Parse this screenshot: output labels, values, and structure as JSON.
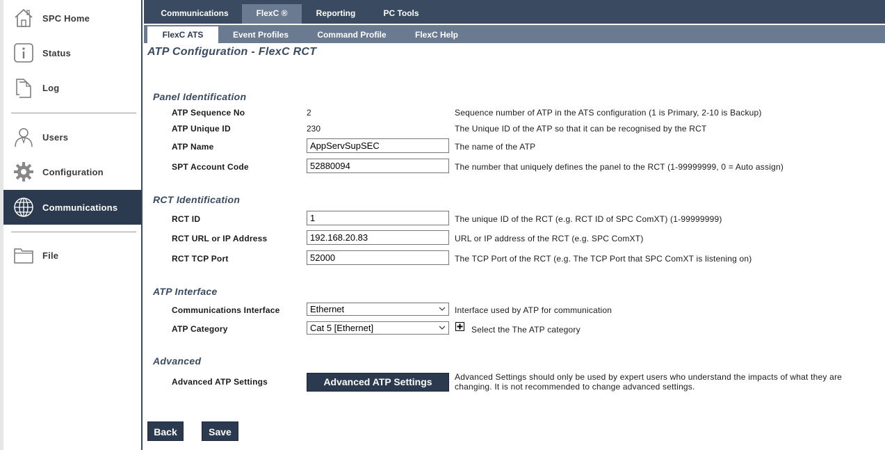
{
  "sidebar": {
    "items": [
      {
        "label": "SPC Home",
        "icon": "house-icon"
      },
      {
        "label": "Status",
        "icon": "info-icon"
      },
      {
        "label": "Log",
        "icon": "document-icon"
      },
      {
        "label": "Users",
        "icon": "user-icon"
      },
      {
        "label": "Configuration",
        "icon": "gear-icon"
      },
      {
        "label": "Communications",
        "icon": "globe-icon",
        "active": true
      },
      {
        "label": "File",
        "icon": "folder-icon"
      }
    ]
  },
  "tabs": [
    "Communications",
    "FlexC ®",
    "Reporting",
    "PC Tools"
  ],
  "active_tab": "FlexC ®",
  "subtabs": [
    "FlexC ATS",
    "Event Profiles",
    "Command Profile",
    "FlexC Help"
  ],
  "active_subtab": "FlexC ATS",
  "page_title": "ATP Configuration - FlexC RCT",
  "sections": {
    "panel_identification": {
      "title": "Panel Identification",
      "sequence_no": {
        "label": "ATP Sequence No",
        "value": "2",
        "desc": "Sequence number of ATP in the ATS configuration (1 is Primary, 2-10 is Backup)"
      },
      "unique_id": {
        "label": "ATP Unique ID",
        "value": "230",
        "desc": "The Unique ID of the ATP so that it can be recognised by the RCT"
      },
      "atp_name": {
        "label": "ATP Name",
        "value": "AppServSupSEC",
        "desc": "The name of the ATP"
      },
      "spt_account": {
        "label": "SPT Account Code",
        "value": "52880094",
        "desc": "The number that uniquely defines the panel to the RCT (1-99999999, 0 = Auto assign)"
      }
    },
    "rct_identification": {
      "title": "RCT Identification",
      "rct_id": {
        "label": "RCT ID",
        "value": "1",
        "desc": "The unique ID of the RCT (e.g. RCT ID of SPC ComXT) (1-99999999)"
      },
      "rct_url": {
        "label": "RCT URL or IP Address",
        "value": "192.168.20.83",
        "desc": "URL or IP address of the RCT (e.g. SPC ComXT)"
      },
      "rct_port": {
        "label": "RCT TCP Port",
        "value": "52000",
        "desc": "The TCP Port of the RCT (e.g. The TCP Port that SPC ComXT is listening on)"
      }
    },
    "atp_interface": {
      "title": "ATP Interface",
      "comm_interface": {
        "label": "Communications Interface",
        "value": "Ethernet",
        "desc": "Interface used by ATP for communication"
      },
      "atp_category": {
        "label": "ATP Category",
        "value": "Cat 5 [Ethernet]",
        "desc": "Select the The ATP category"
      }
    },
    "advanced": {
      "title": "Advanced",
      "label": "Advanced ATP Settings",
      "button": "Advanced ATP Settings",
      "desc_line1": "Advanced Settings should only be used by expert users who understand the impacts of what they are",
      "desc_line2": "changing. It is not recommended to change advanced settings."
    }
  },
  "buttons": {
    "back": "Back",
    "save": "Save"
  },
  "colors": {
    "nav_dark": "#2c3a50",
    "tab_bar": "#3a4a60",
    "subtab_bar": "#6a7a90",
    "heading": "#3a4a60"
  }
}
